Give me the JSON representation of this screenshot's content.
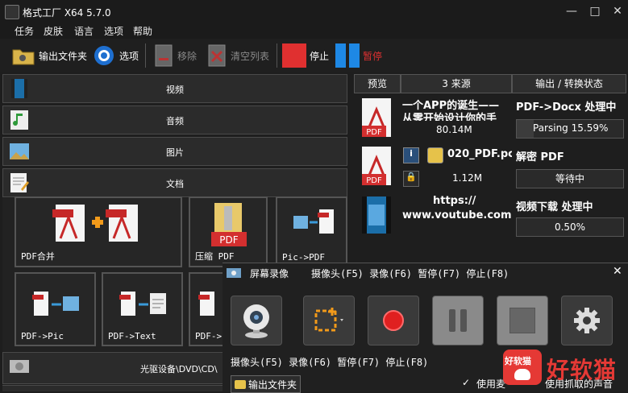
{
  "window": {
    "title": "格式工厂 X64 5.7.0"
  },
  "menu": [
    "任务",
    "皮肤",
    "语言",
    "选项",
    "帮助"
  ],
  "toolbar": {
    "output_folder": "输出文件夹",
    "options": "选项",
    "remove": "移除",
    "clear_list": "清空列表",
    "stop": "停止",
    "pause": "暂停"
  },
  "categories": {
    "video": "视频",
    "audio": "音频",
    "image": "图片",
    "document": "文档",
    "optical": "光驱设备\\DVD\\CD\\"
  },
  "tools": [
    "PDF合并",
    "压缩 PDF",
    "Pic->PDF",
    "PDF->Pic",
    "PDF->Text",
    "PDF->"
  ],
  "task_panel": {
    "headers": {
      "preview": "预览",
      "source": "3 来源",
      "output": "输出 / 转换状态"
    },
    "rows": [
      {
        "source_line1": "一个APP的诞生——",
        "source_line2": "从零开始设计你的手",
        "size": "80.14M",
        "status": "PDF->Docx 处理中",
        "progress_text": "Parsing 15.59%",
        "progress": 0.1559
      },
      {
        "source_line1": "020_PDF.pc",
        "size": "1.12M",
        "status": "解密 PDF",
        "progress_text": "等待中",
        "progress": 0
      },
      {
        "source_line1": "https://",
        "source_line2": "www.voutube.com",
        "status": "视频下载 处理中",
        "progress_text": "0.50%",
        "progress": 0.005
      }
    ]
  },
  "recorder": {
    "title": "屏幕录像",
    "shortcuts": "摄像头(F5) 录像(F6) 暂停(F7) 停止(F8)",
    "shortcuts2": "摄像头(F5) 录像(F6) 暂停(F7) 停止(F8)",
    "output_folder": "输出文件夹",
    "use_mic": "使用麦",
    "use_sound": "使用抓取的声音",
    "close": "✕"
  },
  "watermark": {
    "brand": "好软猫",
    "badge": "好软猫"
  },
  "colors": {
    "accent_red": "#d32f2f",
    "accent_blue": "#1e88e5",
    "background": "#1e1e1e",
    "watermark": "#e53935"
  }
}
